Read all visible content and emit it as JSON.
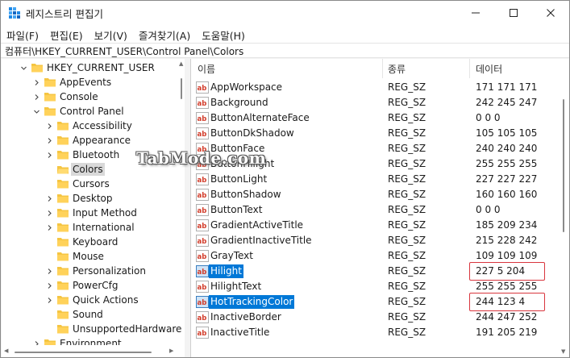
{
  "window": {
    "title": "레지스트리 편집기"
  },
  "menu": [
    "파일(F)",
    "편집(E)",
    "보기(V)",
    "즐겨찾기(A)",
    "도움말(H)"
  ],
  "address": "컴퓨터\\HKEY_CURRENT_USER\\Control Panel\\Colors",
  "tree": [
    {
      "label": "HKEY_CURRENT_USER",
      "level": 0,
      "expander": "open"
    },
    {
      "label": "AppEvents",
      "level": 1,
      "expander": "closed"
    },
    {
      "label": "Console",
      "level": 1,
      "expander": "closed"
    },
    {
      "label": "Control Panel",
      "level": 1,
      "expander": "open"
    },
    {
      "label": "Accessibility",
      "level": 2,
      "expander": "closed"
    },
    {
      "label": "Appearance",
      "level": 2,
      "expander": "closed"
    },
    {
      "label": "Bluetooth",
      "level": 2,
      "expander": "closed"
    },
    {
      "label": "Colors",
      "level": 2,
      "expander": "none",
      "selected": true,
      "open_folder": true
    },
    {
      "label": "Cursors",
      "level": 2,
      "expander": "none"
    },
    {
      "label": "Desktop",
      "level": 2,
      "expander": "closed"
    },
    {
      "label": "Input Method",
      "level": 2,
      "expander": "closed"
    },
    {
      "label": "International",
      "level": 2,
      "expander": "closed"
    },
    {
      "label": "Keyboard",
      "level": 2,
      "expander": "none"
    },
    {
      "label": "Mouse",
      "level": 2,
      "expander": "none"
    },
    {
      "label": "Personalization",
      "level": 2,
      "expander": "closed"
    },
    {
      "label": "PowerCfg",
      "level": 2,
      "expander": "closed"
    },
    {
      "label": "Quick Actions",
      "level": 2,
      "expander": "closed"
    },
    {
      "label": "Sound",
      "level": 2,
      "expander": "none"
    },
    {
      "label": "UnsupportedHardware",
      "level": 2,
      "expander": "none"
    },
    {
      "label": "Environment",
      "level": 1,
      "expander": "closed"
    }
  ],
  "columns": {
    "name": "이름",
    "type": "종류",
    "data": "데이터"
  },
  "values": [
    {
      "name": "AppWorkspace",
      "type": "REG_SZ",
      "data": "171 171 171"
    },
    {
      "name": "Background",
      "type": "REG_SZ",
      "data": "242 245 247"
    },
    {
      "name": "ButtonAlternateFace",
      "type": "REG_SZ",
      "data": "0 0 0"
    },
    {
      "name": "ButtonDkShadow",
      "type": "REG_SZ",
      "data": "105 105 105"
    },
    {
      "name": "ButtonFace",
      "type": "REG_SZ",
      "data": "240 240 240"
    },
    {
      "name": "ButtonHilight",
      "type": "REG_SZ",
      "data": "255 255 255"
    },
    {
      "name": "ButtonLight",
      "type": "REG_SZ",
      "data": "227 227 227"
    },
    {
      "name": "ButtonShadow",
      "type": "REG_SZ",
      "data": "160 160 160"
    },
    {
      "name": "ButtonText",
      "type": "REG_SZ",
      "data": "0 0 0"
    },
    {
      "name": "GradientActiveTitle",
      "type": "REG_SZ",
      "data": "185 209 234"
    },
    {
      "name": "GradientInactiveTitle",
      "type": "REG_SZ",
      "data": "215 228 242"
    },
    {
      "name": "GrayText",
      "type": "REG_SZ",
      "data": "109 109 109"
    },
    {
      "name": "Hilight",
      "type": "REG_SZ",
      "data": "227 5 204",
      "selected": true,
      "boxed": true
    },
    {
      "name": "HilightText",
      "type": "REG_SZ",
      "data": "255 255 255"
    },
    {
      "name": "HotTrackingColor",
      "type": "REG_SZ",
      "data": "244 123 4",
      "selected": true,
      "boxed": true
    },
    {
      "name": "InactiveBorder",
      "type": "REG_SZ",
      "data": "244 247 252"
    },
    {
      "name": "InactiveTitle",
      "type": "REG_SZ",
      "data": "191 205 219"
    }
  ],
  "watermark": "TabMode.com",
  "colors": {
    "selection": "#0078d7",
    "highlight_box": "#d9363e",
    "folder": "#f5c542"
  }
}
